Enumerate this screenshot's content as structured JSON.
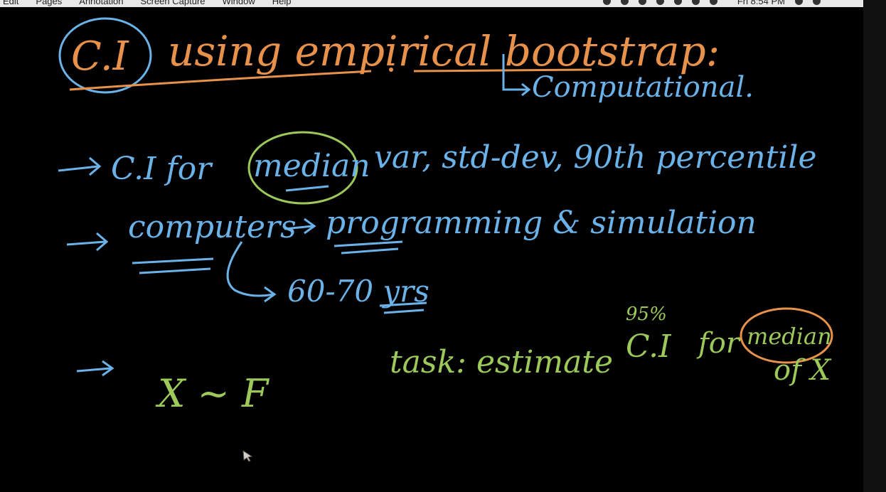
{
  "menubar": {
    "items": [
      "Edit",
      "Pages",
      "Annotation",
      "Screen Capture",
      "Window",
      "Help"
    ],
    "clock": "Fri 8:54 PM"
  },
  "colors": {
    "orange": "#e8914a",
    "blue": "#6ab2e8",
    "green": "#9cc95a",
    "background": "#000000"
  },
  "notes": {
    "title_ci": "C.I",
    "title_rest": "using empirical bootstrap:",
    "computational": "Computational.",
    "line1_ci": "C.I for",
    "line1_median": "median",
    "line1_rest": "var, std-dev, 90th percentile",
    "line2_computers": "computers",
    "line2_rest": "programming & simulation",
    "line3_years": "60-70 yrs",
    "line4_dist": "X ~ F",
    "task_label": "task: estimate",
    "task_pct": "95%",
    "task_ci": "C.I",
    "task_for": "for",
    "task_median": "median",
    "task_of": "of X"
  }
}
